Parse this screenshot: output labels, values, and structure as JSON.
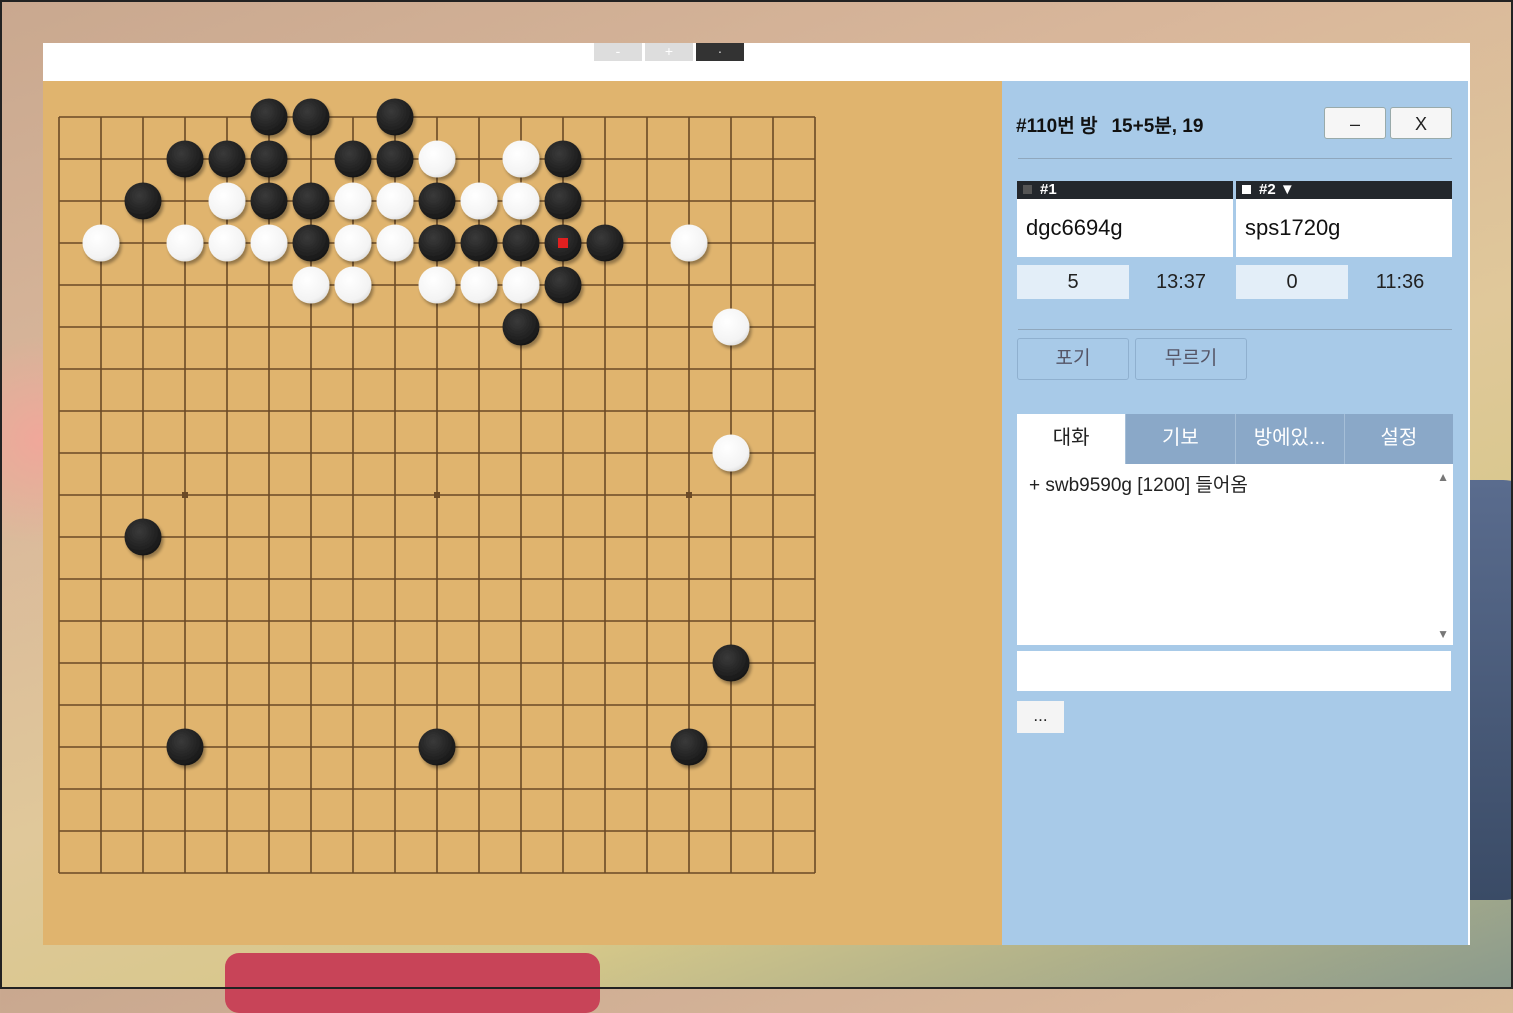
{
  "window_controls": {
    "minus": "-",
    "plus": "+",
    "dot": "·"
  },
  "room": {
    "title": "#110번 방",
    "settings": "15+5분, 19",
    "minimize": "–",
    "close": "X"
  },
  "players": [
    {
      "slot": "#1",
      "name": "dgc6694g",
      "score": "5",
      "time": "13:37",
      "marker_color": "#555555"
    },
    {
      "slot": "#2 ▼",
      "name": "sps1720g",
      "score": "0",
      "time": "11:36",
      "marker_color": "#ffffff"
    }
  ],
  "actions": {
    "resign": "포기",
    "undo": "무르기"
  },
  "tabs": [
    {
      "label": "대화",
      "active": true
    },
    {
      "label": "기보",
      "active": false
    },
    {
      "label": "방에있...",
      "active": false
    },
    {
      "label": "설정",
      "active": false
    }
  ],
  "chat": {
    "messages": [
      "+ swb9590g [1200] 들어옴"
    ],
    "input_value": "",
    "more": "..."
  },
  "board": {
    "size": 19,
    "star_points": [
      [
        3,
        9
      ],
      [
        9,
        9
      ],
      [
        15,
        9
      ]
    ],
    "last_move": [
      12,
      3
    ],
    "black": [
      [
        5,
        0
      ],
      [
        6,
        0
      ],
      [
        8,
        0
      ],
      [
        3,
        1
      ],
      [
        4,
        1
      ],
      [
        5,
        1
      ],
      [
        7,
        1
      ],
      [
        8,
        1
      ],
      [
        12,
        1
      ],
      [
        2,
        2
      ],
      [
        5,
        2
      ],
      [
        6,
        2
      ],
      [
        9,
        2
      ],
      [
        12,
        2
      ],
      [
        6,
        3
      ],
      [
        9,
        3
      ],
      [
        10,
        3
      ],
      [
        11,
        3
      ],
      [
        12,
        3
      ],
      [
        13,
        3
      ],
      [
        12,
        4
      ],
      [
        11,
        5
      ],
      [
        2,
        10
      ],
      [
        16,
        13
      ],
      [
        3,
        15
      ],
      [
        9,
        15
      ],
      [
        15,
        15
      ]
    ],
    "white": [
      [
        9,
        1
      ],
      [
        11,
        1
      ],
      [
        4,
        2
      ],
      [
        7,
        2
      ],
      [
        8,
        2
      ],
      [
        10,
        2
      ],
      [
        11,
        2
      ],
      [
        1,
        3
      ],
      [
        3,
        3
      ],
      [
        4,
        3
      ],
      [
        5,
        3
      ],
      [
        7,
        3
      ],
      [
        8,
        3
      ],
      [
        15,
        3
      ],
      [
        6,
        4
      ],
      [
        7,
        4
      ],
      [
        9,
        4
      ],
      [
        10,
        4
      ],
      [
        11,
        4
      ],
      [
        16,
        5
      ],
      [
        16,
        8
      ]
    ]
  },
  "colors": {
    "board": "#e0b46e",
    "grid": "#6b4a26",
    "panel": "#a8cae8",
    "tab_inactive": "#8aa8c8",
    "last_move_marker": "#e02020"
  }
}
